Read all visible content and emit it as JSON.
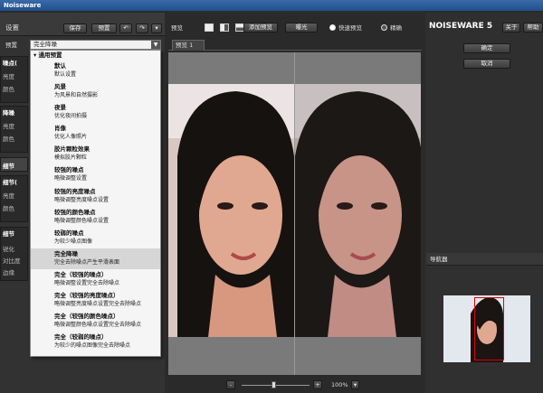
{
  "app": {
    "title": "Noiseware",
    "brand": "NOISEWARE 5"
  },
  "left_panel": {
    "settings_label": "设置",
    "save_label": "保存",
    "preset_button_label": "预置",
    "preset_label": "预置",
    "preset_value": "完全降噪",
    "sections": [
      {
        "title": "噪点(",
        "attrs": [
          "亮度",
          "颜色"
        ]
      },
      {
        "title": "降噪",
        "attrs": [
          "亮度",
          "颜色"
        ]
      },
      {
        "title": "细节",
        "attrs": []
      },
      {
        "title": "细节(",
        "attrs": [
          "亮度",
          "颜色"
        ]
      },
      {
        "title": "细节",
        "attrs": [
          "锐化",
          "对比度",
          "边缘"
        ]
      }
    ]
  },
  "dropdown": {
    "group": "通用预置",
    "items": [
      {
        "name": "默认",
        "desc": "默认设置"
      },
      {
        "name": "风景",
        "desc": "为风景和自然摄影"
      },
      {
        "name": "夜景",
        "desc": "优化夜间拍摄"
      },
      {
        "name": "肖像",
        "desc": "优化人像照片"
      },
      {
        "name": "胶片颗粒效果",
        "desc": "模拟胶片颗粒"
      },
      {
        "name": "较强的噪点",
        "desc": "略微调整设置"
      },
      {
        "name": "较强的亮度噪点",
        "desc": "略微调整亮度噪点设置"
      },
      {
        "name": "较强的颜色噪点",
        "desc": "略微调整颜色噪点设置"
      },
      {
        "name": "较弱的噪点",
        "desc": "为较少噪点图像"
      },
      {
        "name": "完全降噪",
        "desc": "完全去除噪点产生平滑表面"
      },
      {
        "name": "完全（较强的噪点）",
        "desc": "略微调整设置完全去除噪点"
      },
      {
        "name": "完全（较强的亮度噪点）",
        "desc": "略微调整亮度噪点设置完全去除噪点"
      },
      {
        "name": "完全（较强的颜色噪点）",
        "desc": "略微调整颜色噪点设置完全去除噪点"
      },
      {
        "name": "完全（较弱的噪点）",
        "desc": "为较少的噪点图像完全去除噪点"
      }
    ]
  },
  "toolbar": {
    "preview_label": "预览",
    "add_preview": "添加预览",
    "exposure": "曝光",
    "fast_preview": "快速预览",
    "accurate": "精确"
  },
  "tabs": [
    {
      "label": "预览 1"
    }
  ],
  "zoom": {
    "value": "100%",
    "minus": "-",
    "plus": "+"
  },
  "right_panel": {
    "about": "关于",
    "help": "帮助",
    "ok": "确定",
    "cancel": "取消",
    "navigator": "导航器"
  },
  "colors": {
    "accent": "#1f4f8f",
    "panel": "#323232",
    "nav_box": "#e00000"
  }
}
